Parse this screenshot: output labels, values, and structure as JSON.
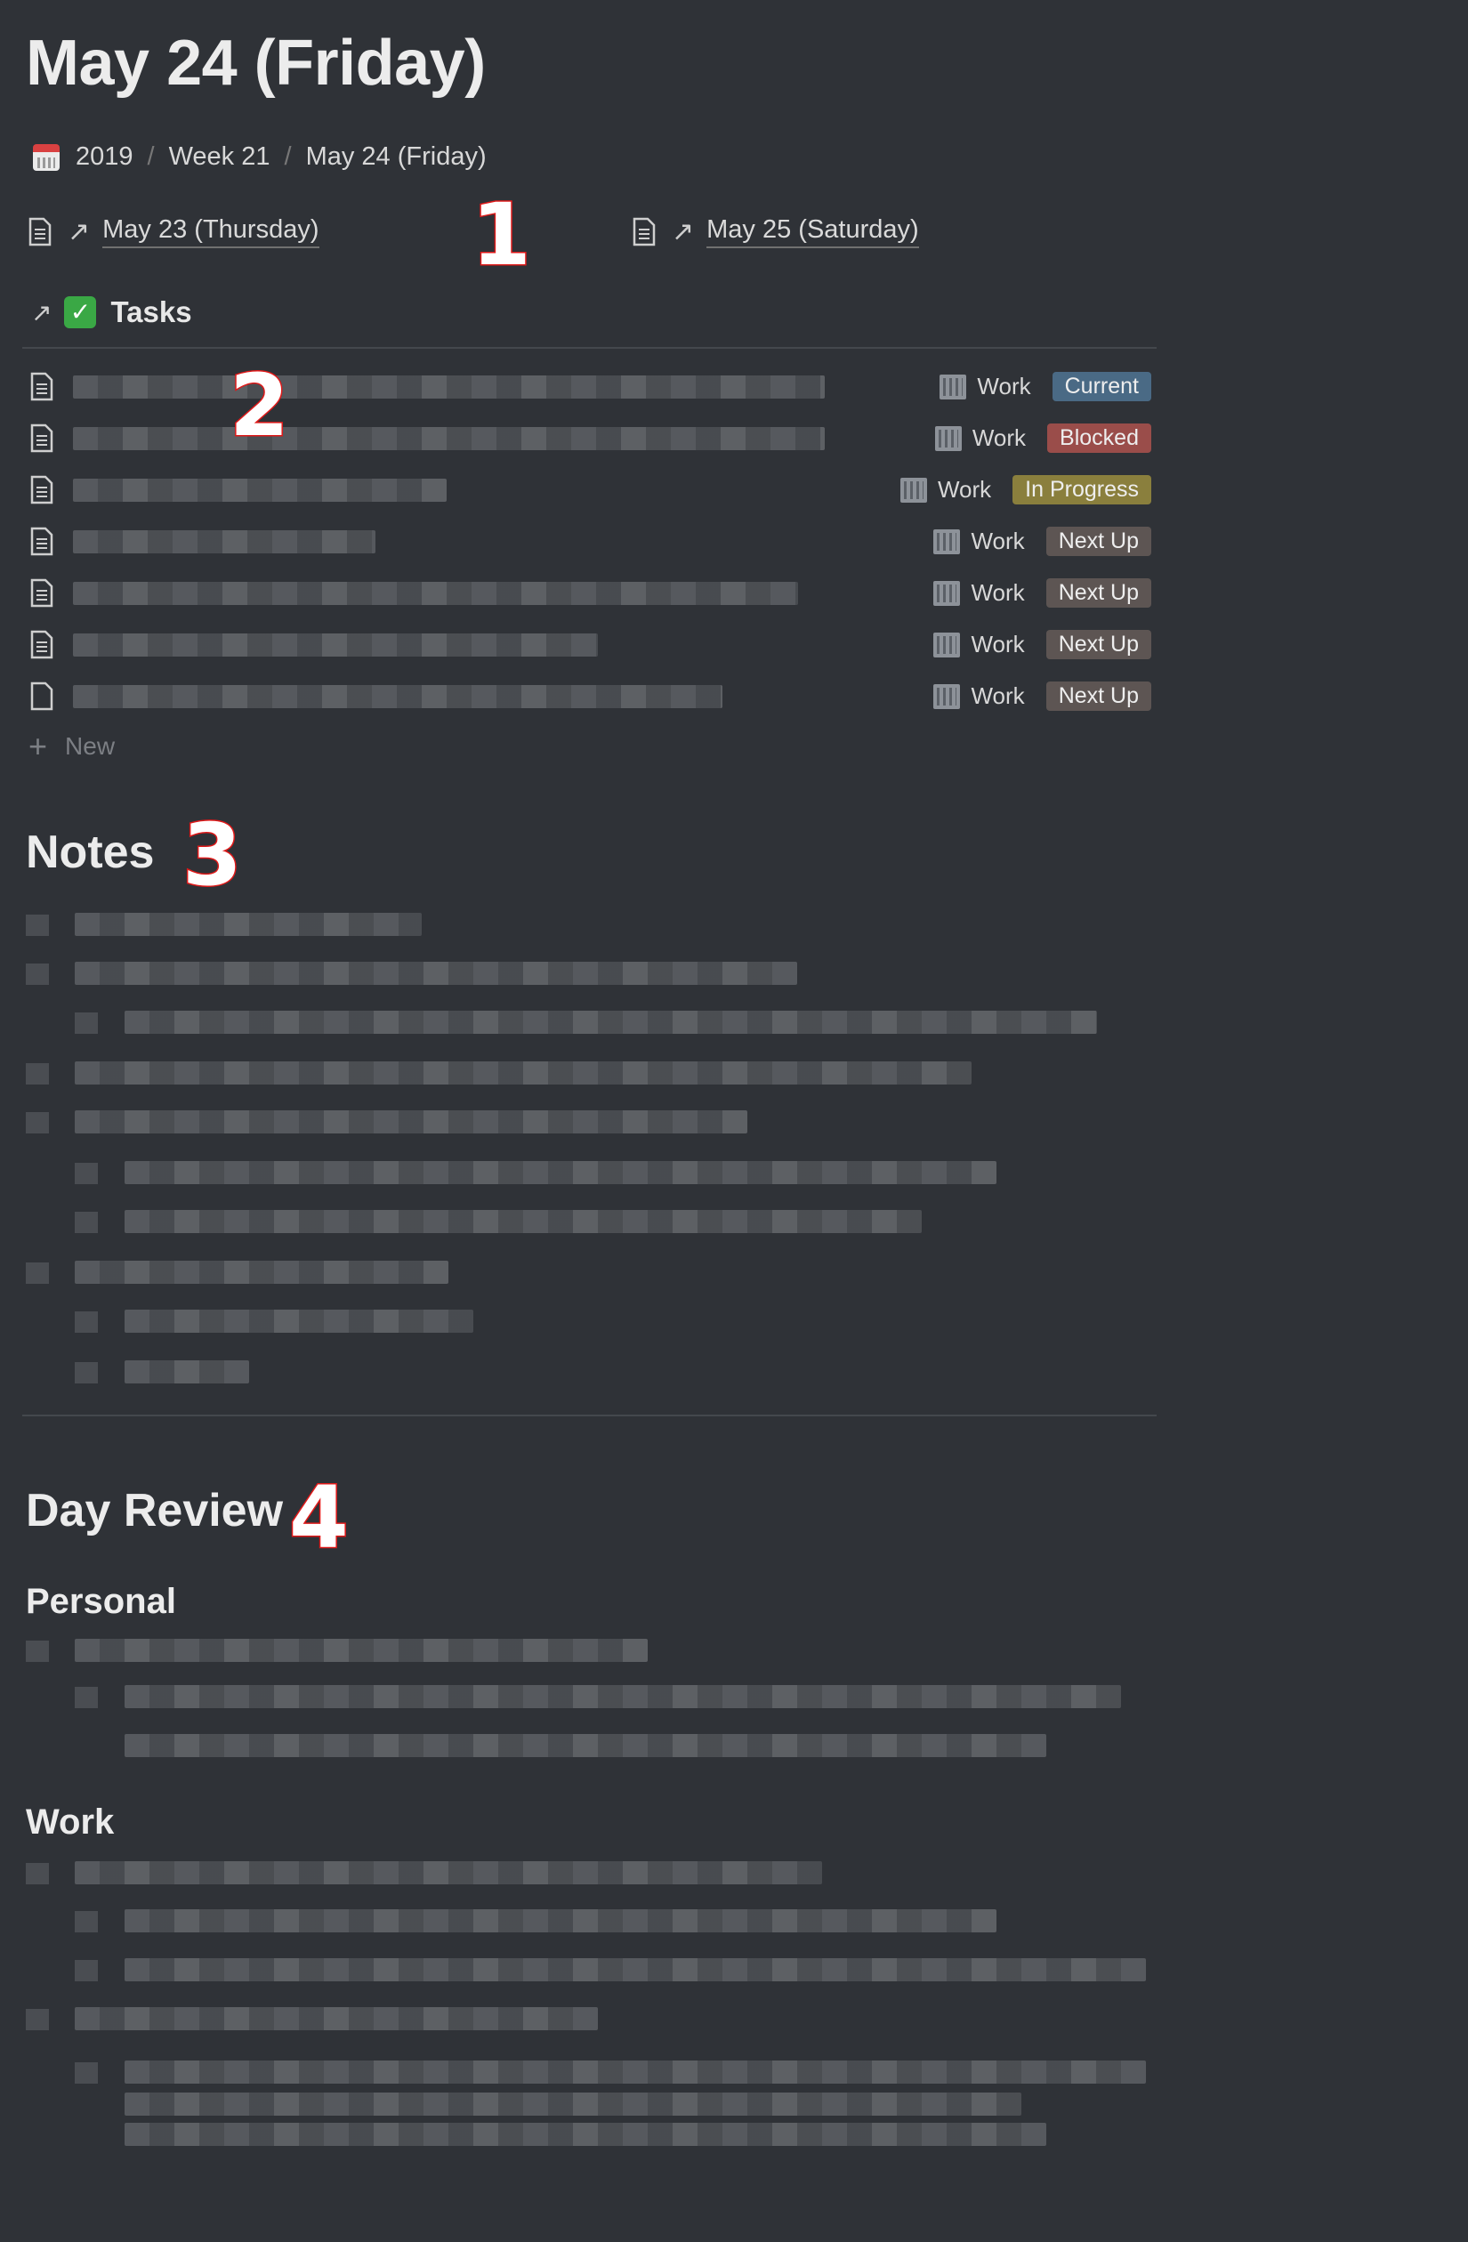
{
  "page": {
    "title": "May 24 (Friday)"
  },
  "breadcrumb": {
    "icon": "calendar-icon",
    "items": [
      "2019",
      "Week 21",
      "May 24 (Friday)"
    ],
    "separator": "/"
  },
  "day_links": {
    "previous": {
      "label": "May 23 (Thursday)",
      "icon": "page-icon",
      "arrow": "↗"
    },
    "next": {
      "label": "May 25 (Saturday)",
      "icon": "page-icon",
      "arrow": "↗"
    }
  },
  "annotations": [
    "1",
    "2",
    "3",
    "4"
  ],
  "tasks": {
    "heading": "Tasks",
    "arrow": "↗",
    "check_icon": "✓",
    "rows": [
      {
        "tag": "Work",
        "status": "Current",
        "status_color": "#4a6a85"
      },
      {
        "tag": "Work",
        "status": "Blocked",
        "status_color": "#9a4d4a"
      },
      {
        "tag": "Work",
        "status": "In Progress",
        "status_color": "#8a7f3d"
      },
      {
        "tag": "Work",
        "status": "Next Up",
        "status_color": "#5d5553"
      },
      {
        "tag": "Work",
        "status": "Next Up",
        "status_color": "#5d5553"
      },
      {
        "tag": "Work",
        "status": "Next Up",
        "status_color": "#5d5553"
      },
      {
        "tag": "Work",
        "status": "Next Up",
        "status_color": "#5d5553"
      }
    ],
    "new_label": "New"
  },
  "notes": {
    "heading": "Notes"
  },
  "day_review": {
    "heading": "Day Review",
    "personal_heading": "Personal",
    "work_heading": "Work"
  }
}
